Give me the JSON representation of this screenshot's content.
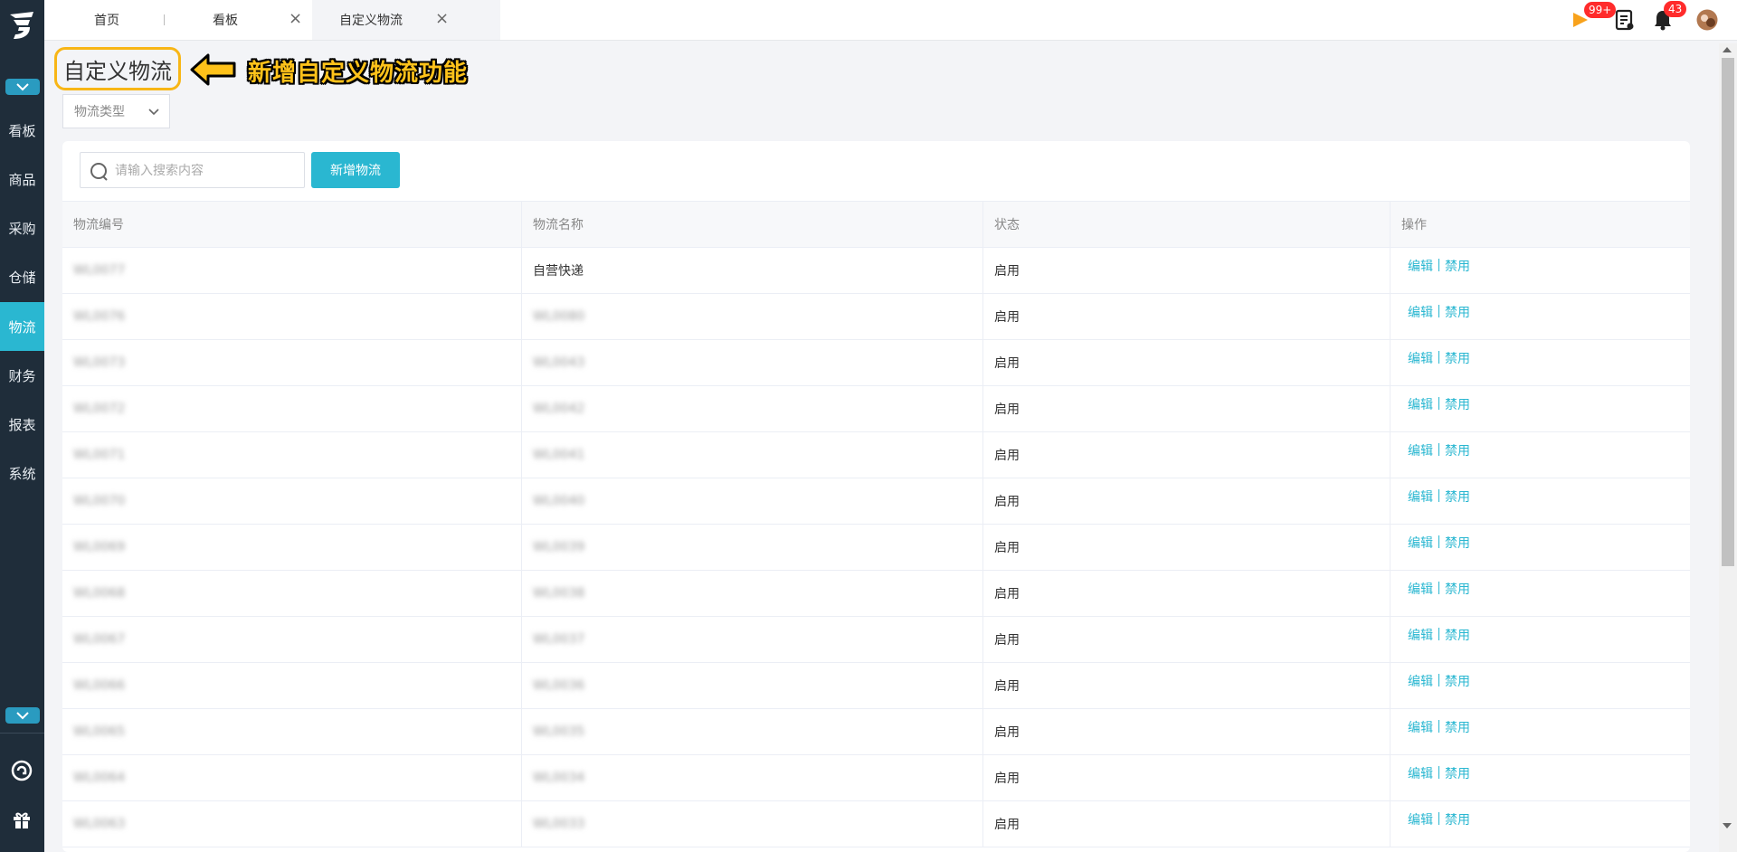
{
  "sidebar": {
    "items": [
      {
        "label": "看板"
      },
      {
        "label": "商品"
      },
      {
        "label": "采购"
      },
      {
        "label": "仓储"
      },
      {
        "label": "物流"
      },
      {
        "label": "财务"
      },
      {
        "label": "报表"
      },
      {
        "label": "系统"
      }
    ],
    "active": "物流"
  },
  "tabs": [
    {
      "label": "首页"
    },
    {
      "label": "看板"
    },
    {
      "label": "自定义物流"
    }
  ],
  "header": {
    "flag_badge": "99+",
    "bell_badge": "43"
  },
  "page": {
    "title": "自定义物流",
    "annotation": "新增自定义物流功能",
    "filter_placeholder": "物流类型"
  },
  "toolbar": {
    "search_placeholder": "请输入搜索内容",
    "add_button": "新增物流"
  },
  "table": {
    "columns": [
      "物流编号",
      "物流名称",
      "状态",
      "操作"
    ],
    "rows": [
      {
        "id": "WL0077",
        "name": "自营快递",
        "name_blurred": false,
        "status": "启用"
      },
      {
        "id": "WL0076",
        "name": "WL0080",
        "name_blurred": true,
        "status": "启用"
      },
      {
        "id": "WL0073",
        "name": "WL0043",
        "name_blurred": true,
        "status": "启用"
      },
      {
        "id": "WL0072",
        "name": "WL0042",
        "name_blurred": true,
        "status": "启用"
      },
      {
        "id": "WL0071",
        "name": "WL0041",
        "name_blurred": true,
        "status": "启用"
      },
      {
        "id": "WL0070",
        "name": "WL0040",
        "name_blurred": true,
        "status": "启用"
      },
      {
        "id": "WL0069",
        "name": "WL0039",
        "name_blurred": true,
        "status": "启用"
      },
      {
        "id": "WL0068",
        "name": "WL0038",
        "name_blurred": true,
        "status": "启用"
      },
      {
        "id": "WL0067",
        "name": "WL0037",
        "name_blurred": true,
        "status": "启用"
      },
      {
        "id": "WL0066",
        "name": "WL0036",
        "name_blurred": true,
        "status": "启用"
      },
      {
        "id": "WL0065",
        "name": "WL0035",
        "name_blurred": true,
        "status": "启用"
      },
      {
        "id": "WL0064",
        "name": "WL0034",
        "name_blurred": true,
        "status": "启用"
      },
      {
        "id": "WL0063",
        "name": "WL0033",
        "name_blurred": true,
        "status": "启用"
      }
    ],
    "actions": {
      "edit": "编辑",
      "disable": "禁用"
    }
  },
  "colors": {
    "accent": "#2ab7d1",
    "sidebar_bg": "#1f2d3a",
    "annotation": "#ffc21a",
    "badge": "#ff2b2b"
  }
}
